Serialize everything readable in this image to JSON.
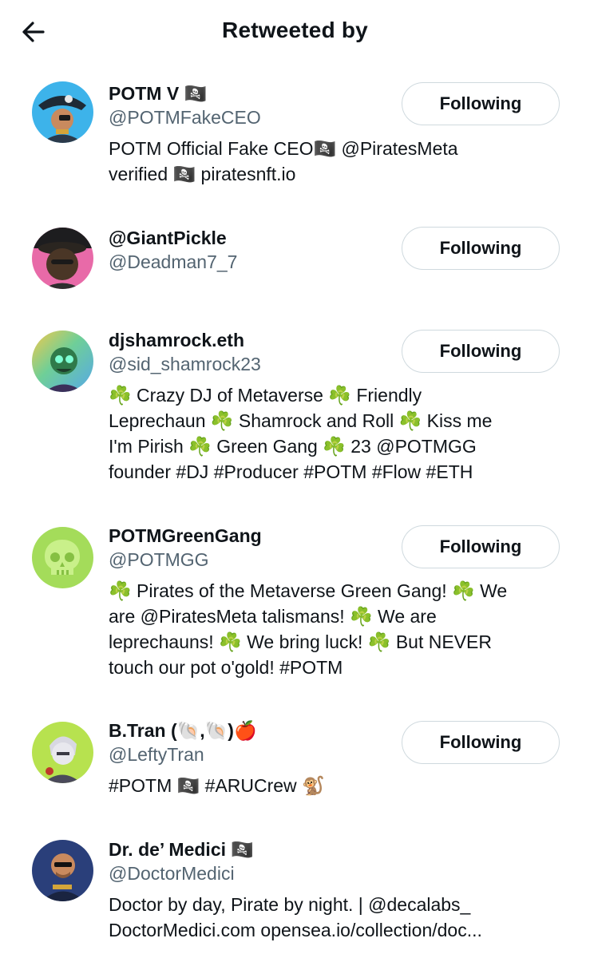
{
  "header": {
    "title": "Retweeted by",
    "back_icon": "arrow-left-icon"
  },
  "users": [
    {
      "name": "POTM V 🏴‍☠️",
      "handle": "@POTMFakeCEO",
      "button": "Following",
      "bio": "POTM Official Fake CEO🏴‍☠️ @PiratesMeta\nverified 🏴‍☠️ piratesnft.io"
    },
    {
      "name": "@GiantPickle",
      "handle": "@Deadman7_7",
      "button": "Following",
      "bio": ""
    },
    {
      "name": "djshamrock.eth",
      "handle": "@sid_shamrock23",
      "button": "Following",
      "bio": "☘️ Crazy DJ of Metaverse ☘️ Friendly\nLeprechaun ☘️ Shamrock and Roll ☘️ Kiss me\nI'm Pirish ☘️ Green Gang ☘️ 23 @POTMGG\nfounder #DJ #Producer #POTM #Flow #ETH"
    },
    {
      "name": "POTMGreenGang",
      "handle": "@POTMGG",
      "button": "Following",
      "bio": "☘️ Pirates of the Metaverse Green Gang! ☘️ We\nare @PiratesMeta talismans! ☘️ We are\nleprechauns! ☘️ We bring luck! ☘️ But NEVER\ntouch our pot o'gold! #POTM"
    },
    {
      "name": "B.Tran (🐚,🐚)🍎",
      "handle": "@LeftyTran",
      "button": "Following",
      "bio": "#POTM 🏴‍☠️ #ARUCrew 🐒"
    },
    {
      "name": "Dr. de’ Medici 🏴‍☠️",
      "handle": "@DoctorMedici",
      "button": "",
      "bio": "Doctor by day, Pirate by night. | @decalabs_\nDoctorMedici.com opensea.io/collection/doc..."
    }
  ]
}
